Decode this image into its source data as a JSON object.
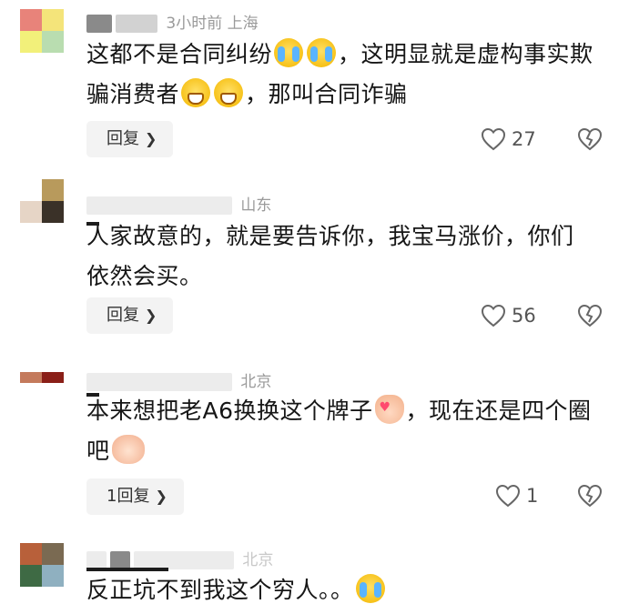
{
  "comments": [
    {
      "meta_text": "3小时前  上海",
      "text_parts": [
        "这都不是合同纠纷",
        "，这明显就是虚构事实欺骗消费者",
        "，那叫合同诈骗"
      ],
      "emoji": [
        "crying-laughing-emoji",
        "grinning-emoji"
      ],
      "reply_label": "回复",
      "likes": "27",
      "avatar_colors": [
        "#e8837a",
        "#f4e47a",
        "#f2f07a",
        "#b9ddb0"
      ]
    },
    {
      "meta_text": "山东",
      "text": "人家故意的，就是要告诉你，我宝马涨价，你们依然会买。",
      "reply_label": "回复",
      "likes": "56",
      "avatar_colors": [
        "#ffffff",
        "#b89a5c",
        "#e6d5c6",
        "#3a3128"
      ]
    },
    {
      "meta_text": "北京",
      "text_parts": [
        "本来想把老A6换换这个牌子",
        "，现在还是四个圈吧"
      ],
      "emoji": [
        "finger-heart-emoji",
        "handshake-emoji"
      ],
      "reply_label": "1回复",
      "likes": "1",
      "avatar_colors": [
        "#c47a5c",
        "#8a1f18",
        "#ffffff",
        "#ffffff"
      ]
    },
    {
      "meta_text": "北京",
      "text": "反正坑不到我这个穷人。。",
      "emoji": [
        "crying-laughing-emoji"
      ],
      "avatar_colors": [
        "#b8603a",
        "#7a6a52",
        "#3e6a44",
        "#8fb0c0"
      ]
    }
  ],
  "icons": {
    "like": "heart-outline-icon",
    "dislike": "broken-heart-icon",
    "reply_chevron": "chevron-right-icon"
  }
}
